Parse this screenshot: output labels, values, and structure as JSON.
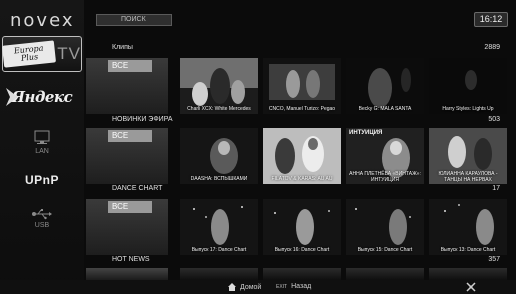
{
  "header": {
    "logo": "novex",
    "search_label": "ПОИСК",
    "clock": "16:12"
  },
  "sidebar": {
    "items": [
      {
        "name": "europa-plus-tv",
        "badge": "Europa Plus",
        "label": "TV"
      },
      {
        "name": "yandex",
        "label": "Яндекс"
      },
      {
        "name": "lan",
        "label": "LAN"
      },
      {
        "name": "upnp",
        "label": "UPnP"
      },
      {
        "name": "usb",
        "label": "USB"
      }
    ]
  },
  "categories": [
    {
      "title": "Клипы",
      "count": "2889",
      "all_label": "ВСЕ",
      "items": [
        {
          "caption": "Charli XCX: White Mercedes"
        },
        {
          "caption": "CNCO, Manuel Turizo: Pegao"
        },
        {
          "caption": "Becky G: MALA SANTA"
        },
        {
          "caption": "Harry Styles: Lights Up"
        }
      ]
    },
    {
      "title": "НОВИНКИ ЭФИРА",
      "count": "503",
      "all_label": "ВСЕ",
      "items": [
        {
          "caption": "DAASHA: ВСПЫШКАМИ"
        },
        {
          "caption": "FILATOV & KARAS: AU AU"
        },
        {
          "caption": "АННА ПЛЕТНЁВА «ВИНТАЖ»: ИНТУИЦИЯ",
          "overlay": "ИНТУИЦИЯ"
        },
        {
          "caption": "ЮЛИАННА КАРАУЛОВА - ТАНЦЫ НА НЕРВАХ"
        }
      ]
    },
    {
      "title": "DANCE CHART",
      "count": "17",
      "all_label": "ВСЕ",
      "items": [
        {
          "caption": "Выпуск 17: Dance Chart"
        },
        {
          "caption": "Выпуск 16: Dance Chart"
        },
        {
          "caption": "Выпуск 15: Dance Chart"
        },
        {
          "caption": "Выпуск 13: Dance Chart"
        }
      ]
    },
    {
      "title": "HOT NEWS",
      "count": "357"
    }
  ],
  "footer": {
    "home_label": "Домой",
    "exit_key": "EXIT",
    "back_label": "Назад"
  },
  "colors": {
    "background": "#0b0b0b",
    "all_tile": "#9a9a9a",
    "text": "#e6e6e6"
  }
}
